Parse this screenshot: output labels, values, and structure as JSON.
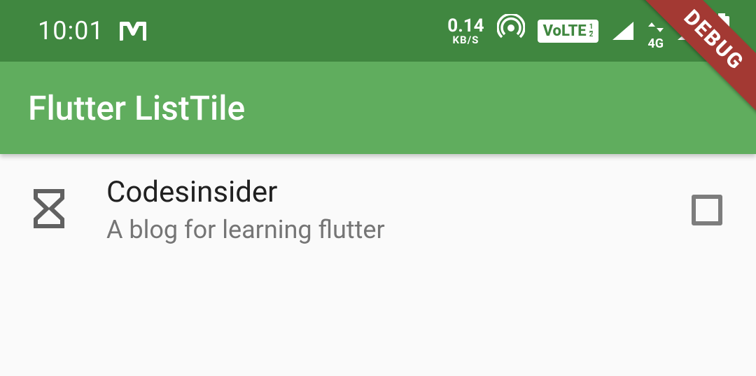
{
  "statusBar": {
    "time": "10:01",
    "speedValue": "0.14",
    "speedUnit": "KB/S",
    "volte": "VoLTE",
    "netLabel": "4G"
  },
  "appBar": {
    "title": "Flutter ListTile"
  },
  "listTile": {
    "title": "Codesinsider",
    "subtitle": "A blog for learning flutter"
  },
  "debugBanner": {
    "label": "DEBUG"
  }
}
